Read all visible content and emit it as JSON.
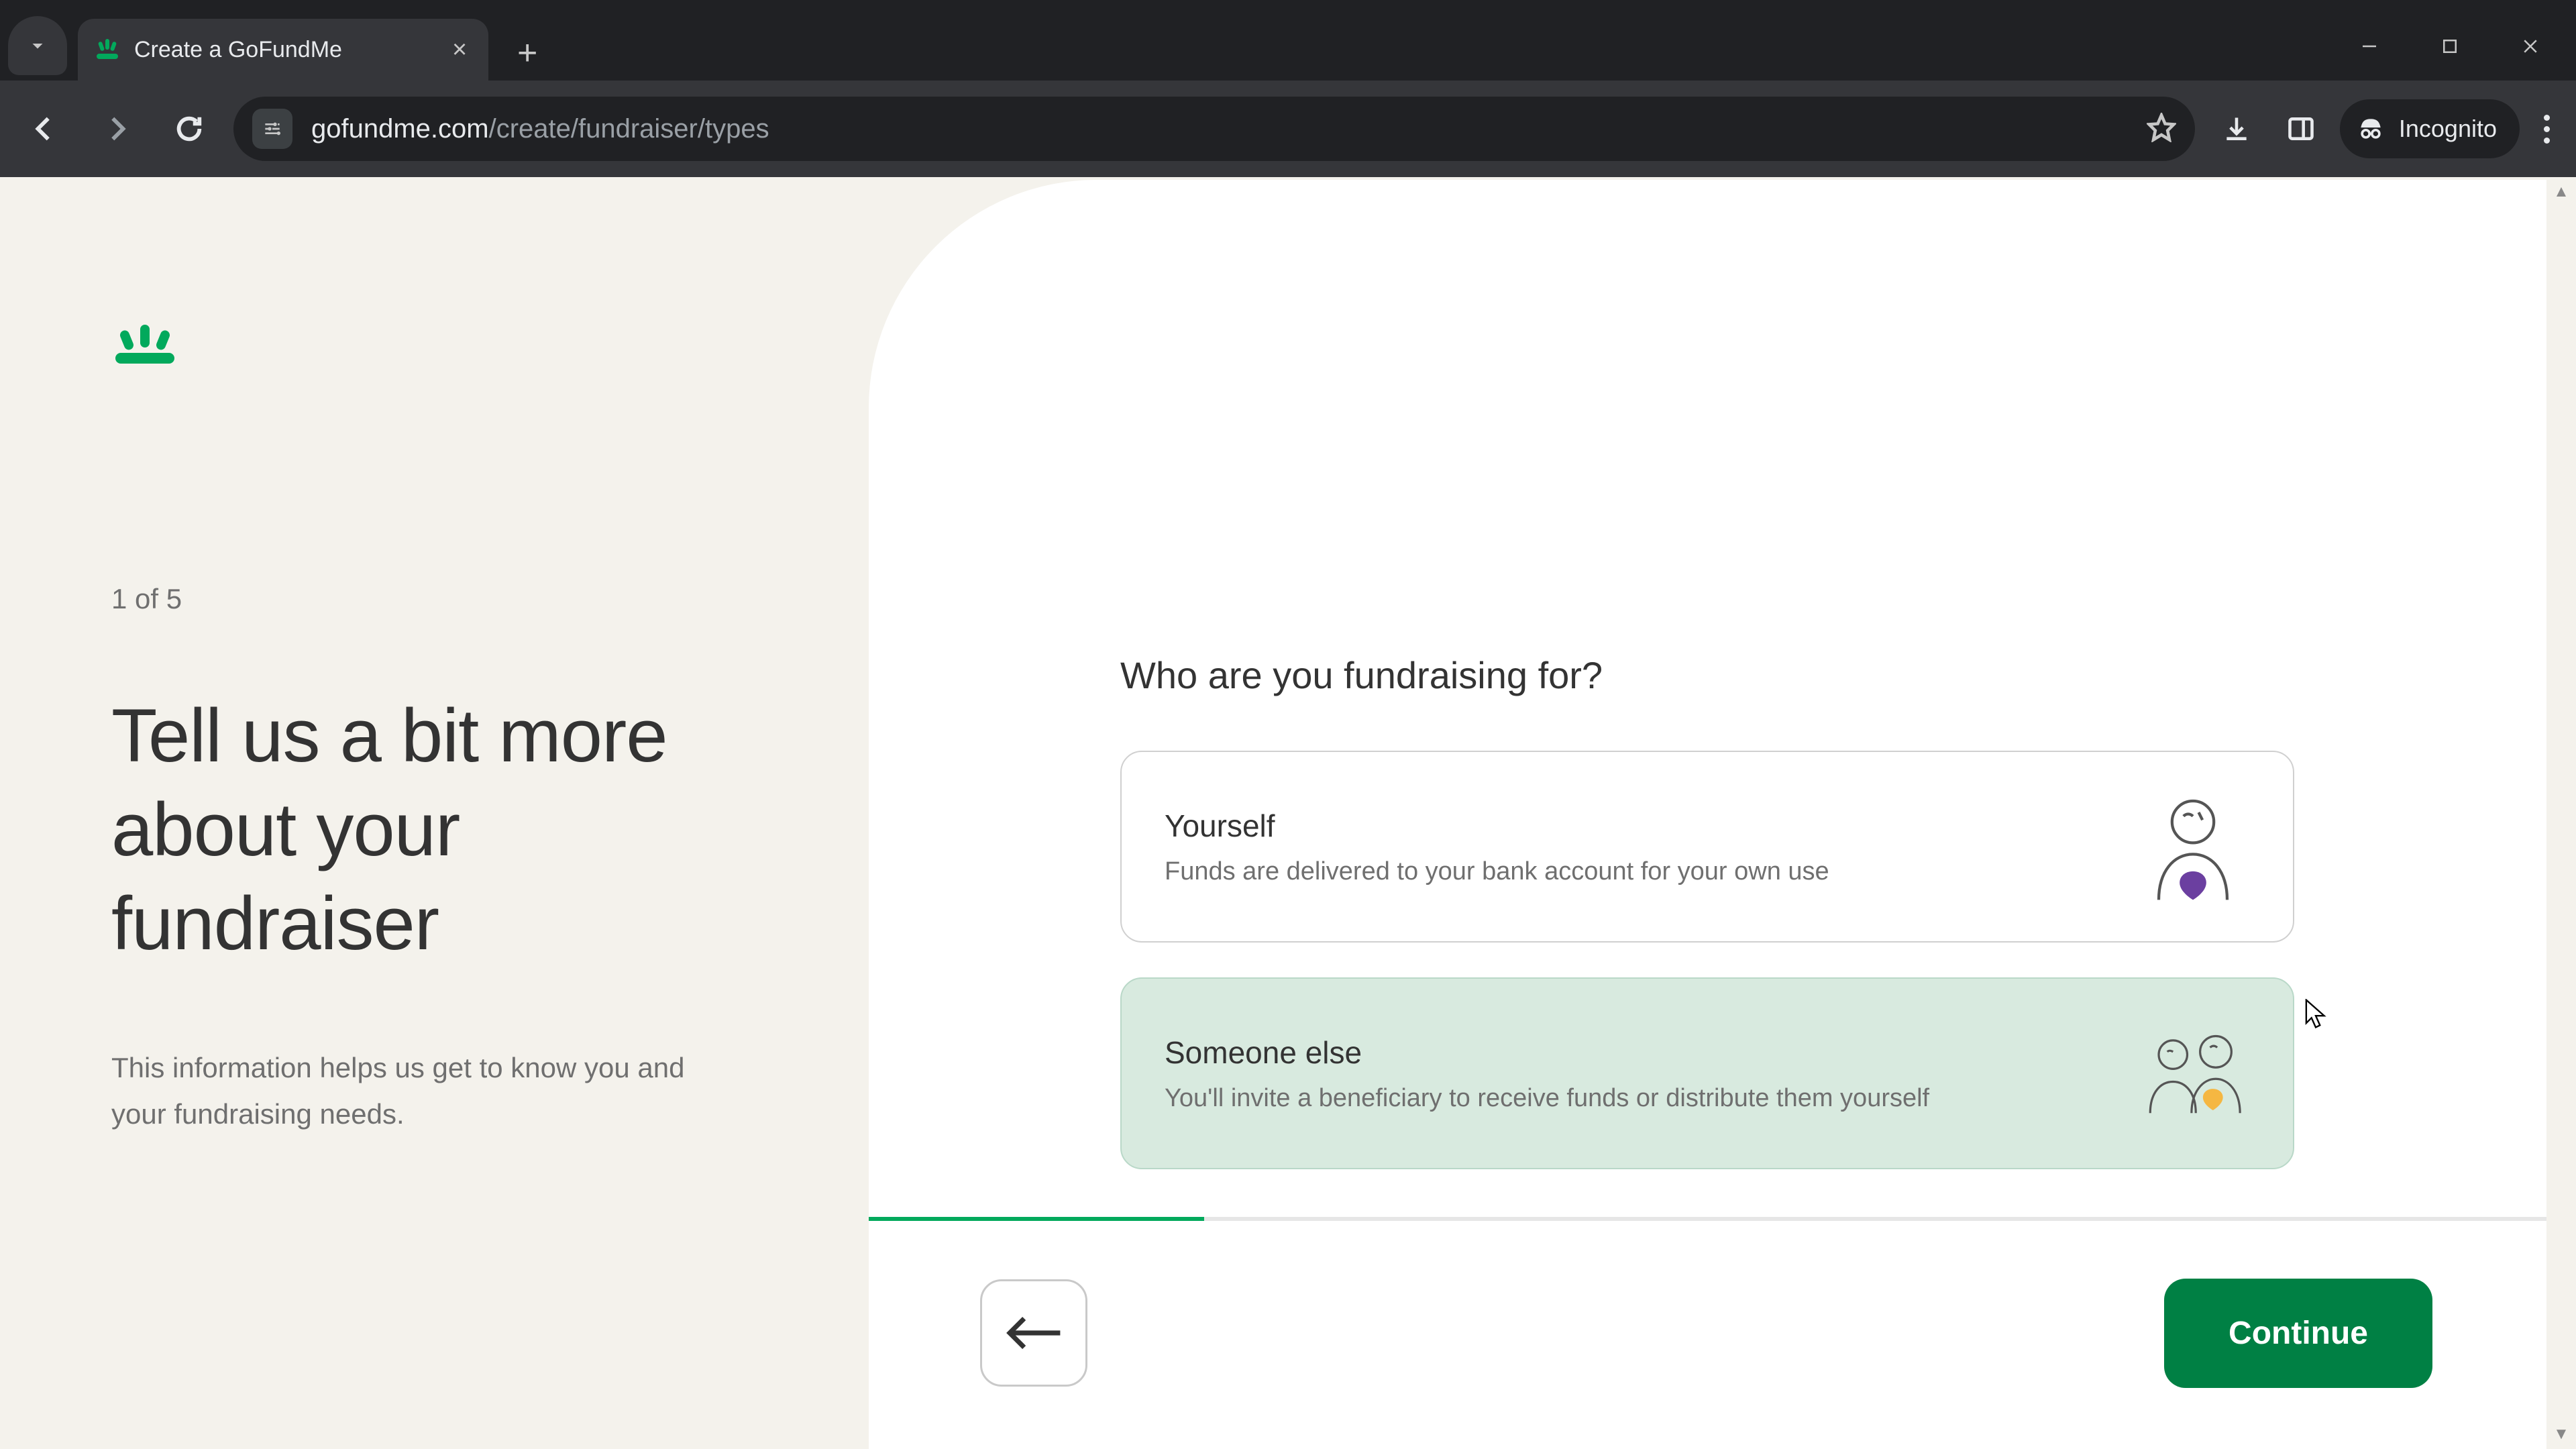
{
  "browser": {
    "tab_title": "Create a GoFundMe",
    "url_host": "gofundme.com",
    "url_path": "/create/fundraiser/types",
    "incognito_label": "Incognito"
  },
  "brand": {
    "color_accent": "#02a95c",
    "color_continue": "#008044"
  },
  "left": {
    "step_counter": "1 of 5",
    "headline": "Tell us a bit more about your fundraiser",
    "subhead": "This information helps us get to know you and your fundraising needs."
  },
  "question": "Who are you fundraising for?",
  "options": [
    {
      "id": "yourself",
      "title": "Yourself",
      "desc": "Funds are delivered to your bank account for your own use",
      "selected": false
    },
    {
      "id": "someone-else",
      "title": "Someone else",
      "desc": "You'll invite a beneficiary to receive funds or distribute them yourself",
      "selected": true
    }
  ],
  "footer": {
    "continue_label": "Continue",
    "progress_percent": 20
  }
}
